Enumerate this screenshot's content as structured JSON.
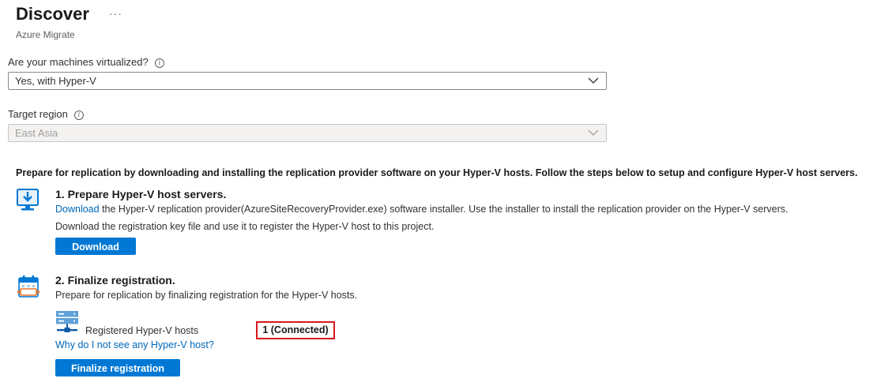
{
  "header": {
    "title": "Discover",
    "more_label": "···",
    "subtitle": "Azure Migrate"
  },
  "form": {
    "virtualized": {
      "label": "Are your machines virtualized?",
      "value": "Yes, with Hyper-V"
    },
    "target_region": {
      "label": "Target region",
      "value": "East Asia",
      "disabled": true
    }
  },
  "intro_text": "Prepare for replication by downloading and installing the replication provider software on your Hyper-V hosts. Follow the steps below to setup and configure Hyper-V host servers.",
  "step1": {
    "title": "1. Prepare Hyper-V host servers.",
    "download_link": "Download",
    "line1_rest": " the Hyper-V replication provider(AzureSiteRecoveryProvider.exe) software installer. Use the installer to install the replication provider on the Hyper-V servers.",
    "line2": "Download the registration key file and use it to register the Hyper-V host to this project.",
    "button_label": "Download"
  },
  "step2": {
    "title": "2. Finalize registration.",
    "description": "Prepare for replication by finalizing registration for the Hyper-V hosts.",
    "hosts_label": "Registered Hyper-V hosts",
    "hosts_status": "1 (Connected)",
    "help_link": "Why do I not see any Hyper-V host?",
    "button_label": "Finalize registration"
  },
  "icons": {
    "step1": "download-monitor-icon",
    "step2": "calendar-icon",
    "hosts": "server-icon",
    "info": "info-icon",
    "dropdown": "chevron-down-icon"
  }
}
